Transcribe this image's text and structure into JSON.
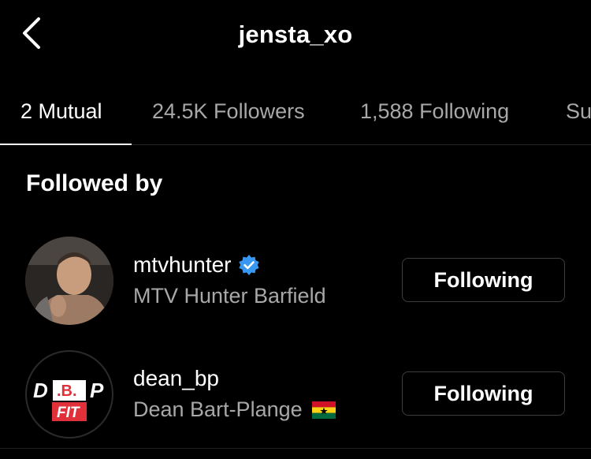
{
  "header": {
    "title": "jensta_xo",
    "back_icon": "chevron-left-icon"
  },
  "tabs": [
    {
      "label": "2 Mutual",
      "active": true
    },
    {
      "label": "24.5K Followers",
      "active": false
    },
    {
      "label": "1,588 Following",
      "active": false
    },
    {
      "label": "Su",
      "active": false
    }
  ],
  "section": {
    "title": "Followed by"
  },
  "users": [
    {
      "username": "mtvhunter",
      "full_name": "MTV Hunter Barfield",
      "verified": true,
      "button_label": "Following",
      "avatar": "profile-photo"
    },
    {
      "username": "dean_bp",
      "full_name": "Dean Bart-Plange",
      "verified": false,
      "flag": "ghana-flag-icon",
      "button_label": "Following",
      "avatar": "dbp-fit-logo",
      "logo": {
        "line1_left": "D",
        "line1_mid": ".B.",
        "line1_right": "P",
        "line2": "FIT"
      }
    }
  ],
  "colors": {
    "background": "#000000",
    "text_primary": "#ffffff",
    "text_secondary": "#a8a8a8",
    "verified_blue": "#3897f0",
    "logo_red": "#e0313b"
  }
}
